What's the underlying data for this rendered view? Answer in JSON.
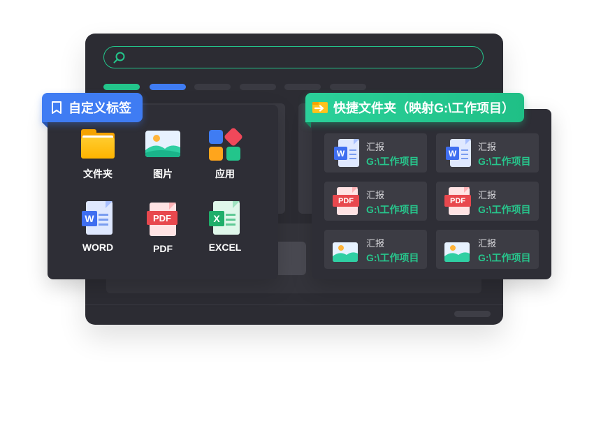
{
  "window": {
    "search": {
      "placeholder": ""
    },
    "tab_pills": [
      {
        "color": "#23c58b"
      },
      {
        "color": "#3f7cf3"
      },
      {
        "color": "#3a3a42"
      },
      {
        "color": "#3a3a42"
      },
      {
        "color": "#3a3a42"
      },
      {
        "color": "#3a3a42"
      }
    ]
  },
  "custom_tags": {
    "title": "自定义标签",
    "items": [
      {
        "label": "文件夹",
        "icon": "folder-icon"
      },
      {
        "label": "图片",
        "icon": "image-icon"
      },
      {
        "label": "应用",
        "icon": "apps-icon"
      },
      {
        "label": "WORD",
        "icon": "word-icon"
      },
      {
        "label": "PDF",
        "icon": "pdf-icon"
      },
      {
        "label": "EXCEL",
        "icon": "excel-icon"
      }
    ]
  },
  "quick_folder": {
    "title": "快捷文件夹（映射G:\\工作项目）",
    "files": [
      {
        "name": "汇报",
        "path": "G:\\工作项目",
        "icon": "word-icon"
      },
      {
        "name": "汇报",
        "path": "G:\\工作项目",
        "icon": "word-icon"
      },
      {
        "name": "汇报",
        "path": "G:\\工作项目",
        "icon": "pdf-icon"
      },
      {
        "name": "汇报",
        "path": "G:\\工作项目",
        "icon": "pdf-icon"
      },
      {
        "name": "汇报",
        "path": "G:\\工作项目",
        "icon": "image-icon"
      },
      {
        "name": "汇报",
        "path": "G:\\工作项目",
        "icon": "image-icon"
      }
    ]
  },
  "icon_text": {
    "word": "W",
    "pdf": "PDF",
    "excel": "X"
  },
  "colors": {
    "accent_green": "#23c58b",
    "accent_blue": "#3f7cf3",
    "pdf_red": "#e8484e"
  }
}
